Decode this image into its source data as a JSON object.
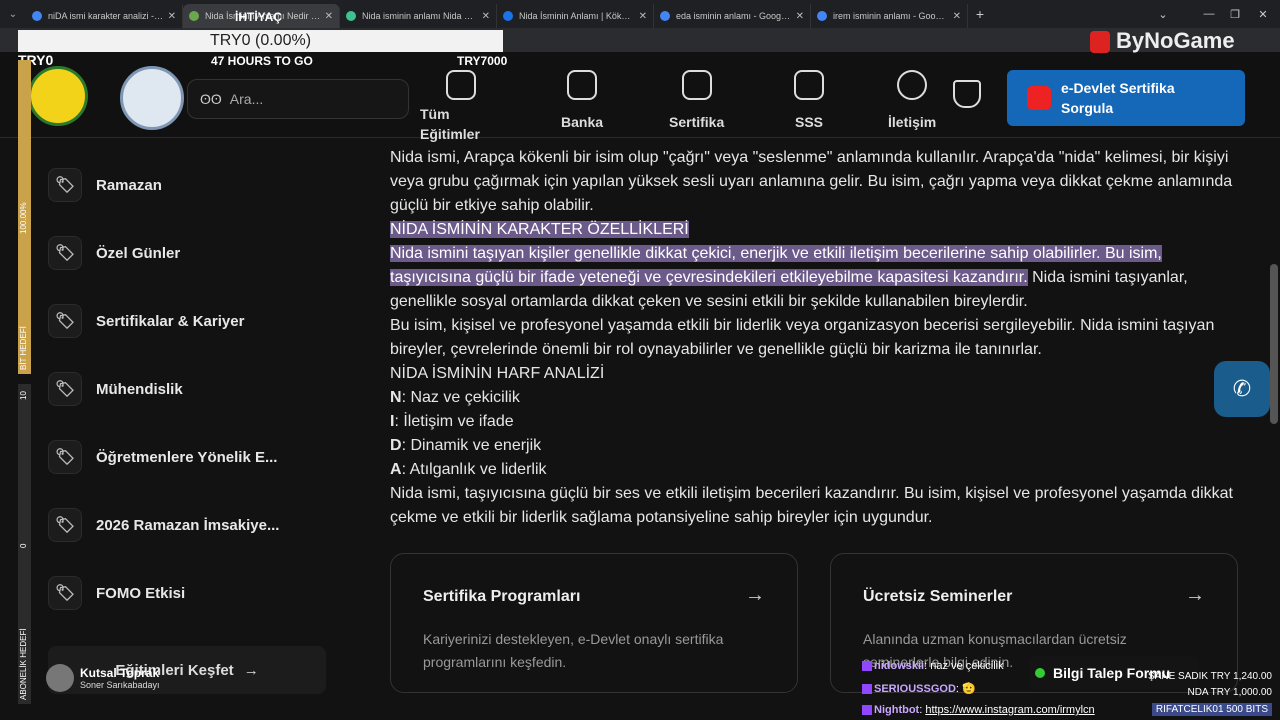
{
  "tabs": [
    {
      "label": "niDA ismi karakter analizi - Goo",
      "active": false,
      "favicon_color": "#4285f4"
    },
    {
      "label": "Nida İsminin Anlamı Nedir - Kö",
      "active": true,
      "favicon_color": "#6aa84f"
    },
    {
      "label": "Nida isminin anlamı Nida ne de",
      "active": false,
      "favicon_color": "#3ec28f"
    },
    {
      "label": "Nida İsminin Anlamı | Kökeni |",
      "active": false,
      "favicon_color": "#1a73e8"
    },
    {
      "label": "eda isminin anlamı - Google'da",
      "active": false,
      "favicon_color": "#4285f4"
    },
    {
      "label": "irem isminin anlamı - Google'd",
      "active": false,
      "favicon_color": "#4285f4"
    }
  ],
  "overlay": {
    "goal_title": "İHTİYAÇ",
    "goal_value": "TRY0 (0.00%)",
    "goal_left": "TRY0",
    "goal_time": "47 HOURS TO GO",
    "goal_right": "TRY7000",
    "vbar1_top": "100.00%",
    "vbar1_bottom": "BİT HEDEFİ",
    "vbar2_top": "10",
    "vbar2_mid": "0",
    "vbar2_bottom": "ABONELİK HEDEFİ",
    "brand": "ByNoGame",
    "streamer_name": "Kutsal Toprak",
    "streamer_sub": "Soner Sarıkabadayı"
  },
  "header": {
    "search_placeholder": "Ara...",
    "nav": [
      {
        "label": "Tüm Eğitimler"
      },
      {
        "label": "Banka"
      },
      {
        "label": "Sertifika"
      },
      {
        "label": "SSS"
      },
      {
        "label": "İletişim"
      }
    ],
    "edevlet_label": "e-Devlet Sertifika Sorgula"
  },
  "sidebar": {
    "items": [
      {
        "label": "Ramazan"
      },
      {
        "label": "Özel Günler"
      },
      {
        "label": "Sertifikalar & Kariyer"
      },
      {
        "label": "Mühendislik"
      },
      {
        "label": "Öğretmenlere Yönelik E..."
      },
      {
        "label": "2026 Ramazan İmsakiye..."
      },
      {
        "label": "FOMO Etkisi"
      }
    ],
    "explore_label": "Eğitimleri Keşfet"
  },
  "article": {
    "p1": "Nida ismi, Arapça kökenli bir isim olup \"çağrı\" veya \"seslenme\" anlamında kullanılır. Arapça'da \"nida\" kelimesi, bir kişiyi veya grubu çağırmak için yapılan yüksek sesli uyarı anlamına gelir. Bu isim, çağrı yapma veya dikkat çekme anlamında güçlü bir etkiye sahip olabilir.",
    "h_character": "NİDA İSMİNİN KARAKTER ÖZELLİKLERİ",
    "p2_highlight": "Nida ismini taşıyan kişiler genellikle dikkat çekici, enerjik ve etkili iletişim becerilerine sahip olabilirler. Bu isim, taşıyıcısına güçlü bir ifade yeteneği ve çevresindekileri etkileyebilme kapasitesi kazandırır.",
    "p2_rest": " Nida ismini taşıyanlar, genellikle sosyal ortamlarda dikkat çeken ve sesini etkili bir şekilde kullanabilen bireylerdir.",
    "p3": "Bu isim, kişisel ve profesyonel yaşamda etkili bir liderlik veya organizasyon becerisi sergileyebilir. Nida ismini taşıyan bireyler, çevrelerinde önemli bir rol oynayabilirler ve genellikle güçlü bir karizma ile tanınırlar.",
    "h_letters": "NİDA İSMİNİN HARF ANALİZİ",
    "letters": [
      {
        "letter": "N",
        "text": ": Naz ve çekicilik"
      },
      {
        "letter": "I",
        "text": ": İletişim ve ifade"
      },
      {
        "letter": "D",
        "text": ": Dinamik ve enerjik"
      },
      {
        "letter": "A",
        "text": ": Atılganlık ve liderlik"
      }
    ],
    "p4": "Nida ismi, taşıyıcısına güçlü bir ses ve etkili iletişim becerileri kazandırır. Bu isim, kişisel ve profesyonel yaşamda dikkat çekme ve etkili bir liderlik sağlama potansiyeline sahip bireyler için uygundur."
  },
  "cards": [
    {
      "title": "Sertifika Programları",
      "desc": "Kariyerinizi destekleyen, e-Devlet onaylı sertifika programlarını keşfedin."
    },
    {
      "title": "Ücretsiz Seminerler",
      "desc": "Alanında uzman konuşmacılardan ücretsiz seminerlerle bilgi edinin."
    }
  ],
  "bilgi_label": "Bilgi Talep Formu",
  "chat": [
    {
      "user": "nidowskii",
      "msg": "naz ve çekicilik"
    },
    {
      "user": "SERIOUSSGOD",
      "msg": "🫡"
    },
    {
      "user": "Nightbot",
      "msg": "https://www.instagram.com/irmylcn"
    }
  ],
  "donations": [
    {
      "text": "ŞANE SADIK  TRY 1,240.00"
    },
    {
      "text": "NDA  TRY 1,000.00"
    },
    {
      "text": "RIFATCELIK01  500 BITS"
    }
  ]
}
